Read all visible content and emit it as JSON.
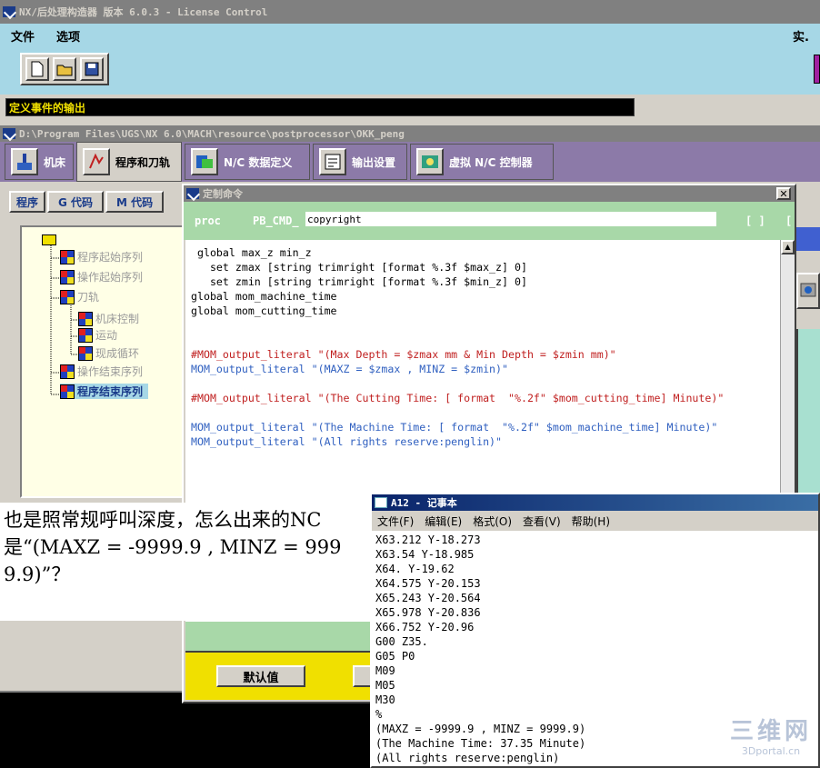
{
  "main_window": {
    "title": "NX/后处理构造器 版本 6.0.3 - License Control",
    "menu": [
      "文件",
      "选项"
    ],
    "menu_right": "实.",
    "status_text": "定义事件的输出"
  },
  "doc_window": {
    "path": "D:\\Program Files\\UGS\\NX 6.0\\MACH\\resource\\postprocessor\\OKK_peng",
    "tabs": [
      "机床",
      "程序和刀轨",
      "N/C 数据定义",
      "输出设置",
      "虚拟 N/C 控制器"
    ],
    "subtabs": [
      "程序",
      "G 代码",
      "M 代码"
    ],
    "tree": {
      "items": [
        {
          "label": "程序起始序列",
          "level": 1
        },
        {
          "label": "操作起始序列",
          "level": 1
        },
        {
          "label": "刀轨",
          "level": 1
        },
        {
          "label": "机床控制",
          "level": 2
        },
        {
          "label": "运动",
          "level": 2
        },
        {
          "label": "现成循环",
          "level": 2
        },
        {
          "label": "操作结束序列",
          "level": 1
        },
        {
          "label": "程序结束序列",
          "level": 1,
          "selected": true
        }
      ]
    }
  },
  "custom_dialog": {
    "title": "定制命令",
    "proc_label": "proc",
    "prefix": "PB_CMD_",
    "name_value": "copyright",
    "bracket_left": "[ ]",
    "bracket_right": "[",
    "code_lines": [
      {
        "text": " global max_z min_z",
        "color": "#000000"
      },
      {
        "text": "   set zmax [string trimright [format %.3f $max_z] 0]",
        "color": "#000000"
      },
      {
        "text": "   set zmin [string trimright [format %.3f $min_z] 0]",
        "color": "#000000"
      },
      {
        "text": "global mom_machine_time",
        "color": "#000000"
      },
      {
        "text": "global mom_cutting_time",
        "color": "#000000"
      },
      {
        "text": "",
        "color": "#000000"
      },
      {
        "text": "",
        "color": "#000000"
      },
      {
        "text": "#MOM_output_literal \"(Max Depth = $zmax mm & Min Depth = $zmin mm)\"",
        "color": "#000000"
      },
      {
        "text": "MOM_output_literal \"(MAXZ = $zmax , MINZ = $zmin)\"",
        "color": "#000000"
      },
      {
        "text": "",
        "color": "#000000"
      },
      {
        "text": "#MOM_output_literal \"(The Cutting Time: [ format  \"%.2f\" $mom_cutting_time] Minute)\"",
        "color": "#000000"
      },
      {
        "text": "",
        "color": "#000000"
      },
      {
        "text": "MOM_output_literal \"(The Machine Time: [ format  \"%.2f\" $mom_machine_time] Minute)\"",
        "color": "#000000"
      },
      {
        "text": "MOM_output_literal \"(All rights reserve:penglin)\"",
        "color": "#000000"
      }
    ],
    "default_button": "默认值"
  },
  "question_text": "也是照常规呼叫深度，怎么出来的NC是“(MAXZ = -9999.9 , MINZ = 9999.9)”？",
  "notepad": {
    "title": "A12 - 记事本",
    "menu": [
      "文件(F)",
      "编辑(E)",
      "格式(O)",
      "查看(V)",
      "帮助(H)"
    ],
    "lines": [
      "X63.212 Y-18.273",
      "X63.54 Y-18.985",
      "X64. Y-19.62",
      "X64.575 Y-20.153",
      "X65.243 Y-20.564",
      "X65.978 Y-20.836",
      "X66.752 Y-20.96",
      "G00 Z35.",
      "G05 P0",
      "M09",
      "M05",
      "M30",
      "%",
      "(MAXZ = -9999.9 , MINZ = 9999.9)",
      "(The Machine Time: 37.35 Minute)",
      "(All rights reserve:penglin)"
    ]
  },
  "watermark": {
    "brand": "三维网",
    "site": "3Dportal.cn"
  },
  "colors": {
    "menu_bg": "#a6d7e6",
    "tab_purple": "#8c7aa8",
    "dialog_green": "#a8d8a8",
    "tree_bg": "#ffffe6",
    "teal": "#a8e0d0",
    "button_yellow": "#f0e000"
  }
}
